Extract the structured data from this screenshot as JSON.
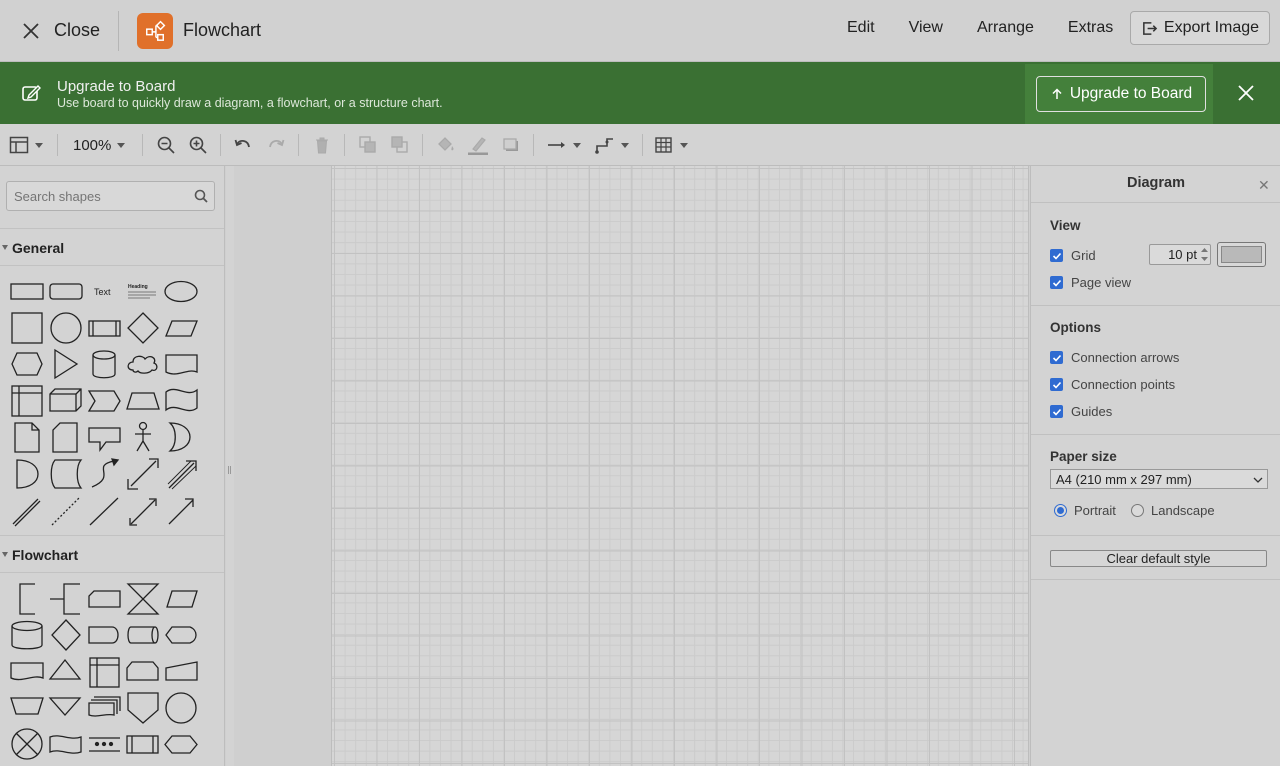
{
  "topbar": {
    "close_label": "Close",
    "app_title": "Flowchart",
    "app_icon": "flowchart-icon",
    "app_icon_color": "#e0702a",
    "menu": [
      "Edit",
      "View",
      "Arrange",
      "Extras"
    ],
    "export_label": "Export Image"
  },
  "banner": {
    "title": "Upgrade to Board",
    "subtitle": "Use board to quickly draw a diagram, a flowchart, or a structure chart.",
    "button_label": "Upgrade to Board",
    "background": "#3a7033"
  },
  "toolbar": {
    "zoom": "100%",
    "icons": [
      "format-panel-icon",
      "zoom-out-icon",
      "zoom-in-icon",
      "undo-icon",
      "redo-icon",
      "delete-icon",
      "to-front-icon",
      "to-back-icon",
      "fill-color-icon",
      "line-color-icon",
      "shadow-icon",
      "connection-icon",
      "waypoints-icon",
      "table-icon"
    ]
  },
  "sidebar": {
    "search_placeholder": "Search shapes",
    "sections": [
      {
        "title": "General",
        "text_shape": "Text",
        "heading_shape": "Heading"
      },
      {
        "title": "Flowchart"
      }
    ]
  },
  "panel": {
    "title": "Diagram",
    "close": "✕",
    "view_label": "View",
    "grid_label": "Grid",
    "grid_size": "10 pt",
    "page_view_label": "Page view",
    "options_label": "Options",
    "options": [
      "Connection arrows",
      "Connection points",
      "Guides"
    ],
    "paper_size_label": "Paper size",
    "paper_size": "A4 (210 mm x 297 mm)",
    "orientation": {
      "portrait": "Portrait",
      "landscape": "Landscape",
      "selected": "Portrait"
    },
    "clear_label": "Clear default style",
    "accent": "#2f6bd1"
  }
}
